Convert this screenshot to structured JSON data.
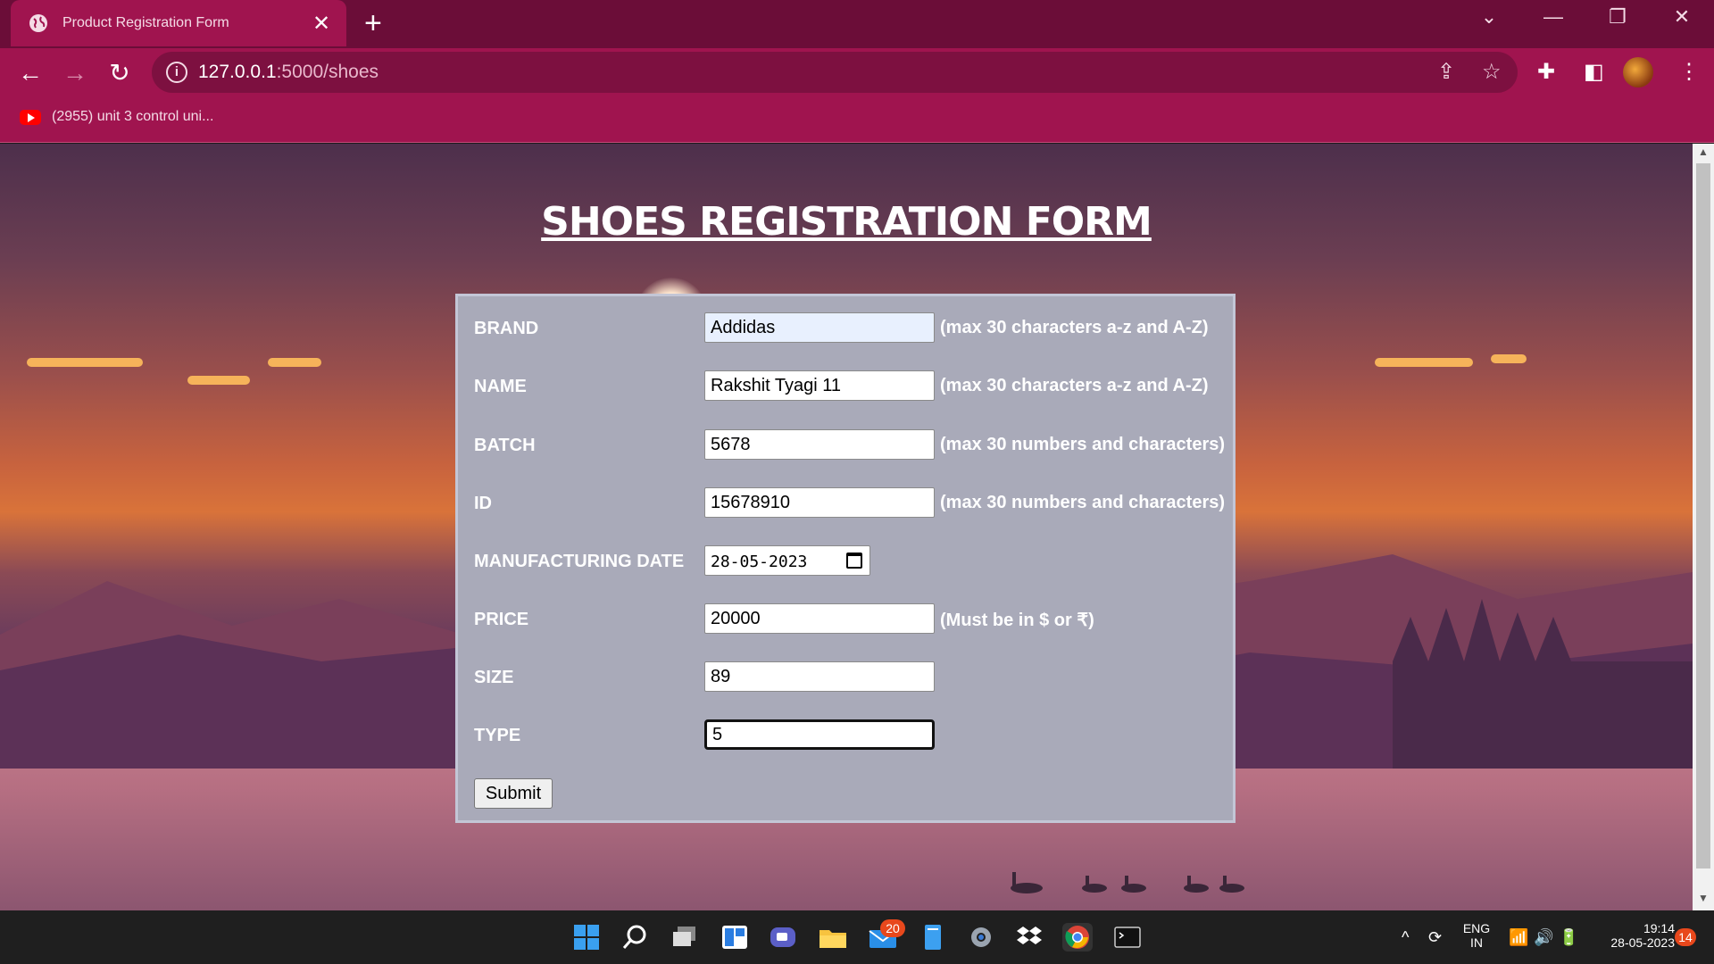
{
  "browser": {
    "tab_title": "Product Registration Form",
    "tab_close": "✕",
    "new_tab": "+",
    "win_controls": {
      "dropdown": "⌄",
      "minimize": "—",
      "restore": "❐",
      "close": "✕"
    },
    "url_host": "127.0.0.1",
    "url_path": ":5000/shoes",
    "bookmark": "(2955) unit 3 control uni...",
    "accent": "#a0144f",
    "tabbar_color": "#6b0d38"
  },
  "page": {
    "title": "SHOES REGISTRATION FORM",
    "fields": [
      {
        "label": "BRAND",
        "value": "Addidas",
        "hint": "(max 30 characters a-z and A-Z)"
      },
      {
        "label": "NAME",
        "value": "Rakshit Tyagi 11",
        "hint": "(max 30 characters a-z and A-Z)"
      },
      {
        "label": "BATCH",
        "value": "5678",
        "hint": "(max 30 numbers and characters)"
      },
      {
        "label": "ID",
        "value": "15678910",
        "hint": "(max 30 numbers and characters)"
      },
      {
        "label": "MANUFACTURING DATE",
        "value": "28-05-2023",
        "hint": ""
      },
      {
        "label": "PRICE",
        "value": "20000",
        "hint": "(Must be in $ or ₹)"
      },
      {
        "label": "SIZE",
        "value": "89",
        "hint": ""
      },
      {
        "label": "TYPE",
        "value": "5",
        "hint": ""
      }
    ],
    "date_display": "28-05-2023",
    "submit_label": "Submit",
    "panel_color": "#a9aab9"
  },
  "taskbar": {
    "mail_badge": "20",
    "lang_top": "ENG",
    "lang_bottom": "IN",
    "time": "19:14",
    "date": "28-05-2023",
    "notifications": "14"
  }
}
